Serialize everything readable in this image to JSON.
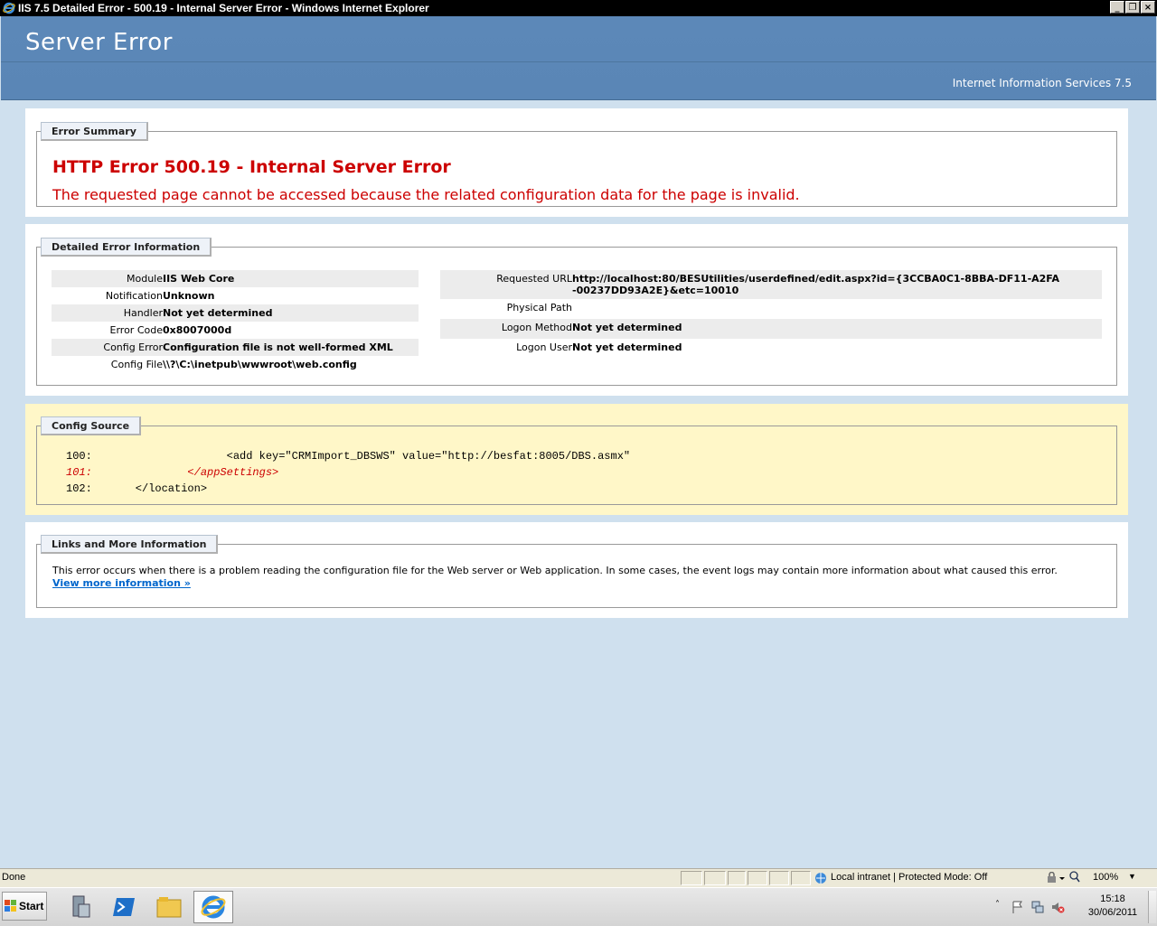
{
  "window": {
    "title": "IIS 7.5 Detailed Error - 500.19 - Internal Server Error - Windows Internet Explorer",
    "minimize": "_",
    "restore": "❐",
    "close": "×"
  },
  "header": {
    "title": "Server Error",
    "product": "Internet Information Services 7.5"
  },
  "summary": {
    "legend": "Error Summary",
    "heading": "HTTP Error 500.19 - Internal Server Error",
    "description": "The requested page cannot be accessed because the related configuration data for the page is invalid."
  },
  "details": {
    "legend": "Detailed Error Information",
    "left": [
      {
        "key": "Module",
        "value": "IIS Web Core"
      },
      {
        "key": "Notification",
        "value": "Unknown"
      },
      {
        "key": "Handler",
        "value": "Not yet determined"
      },
      {
        "key": "Error Code",
        "value": "0x8007000d"
      },
      {
        "key": "Config Error",
        "value": "Configuration file is not well-formed XML"
      },
      {
        "key": "Config File",
        "value": "\\\\?\\C:\\inetpub\\wwwroot\\web.config"
      }
    ],
    "right": [
      {
        "key": "Requested URL",
        "value": "http://localhost:80/BESUtilities/userdefined/edit.aspx?id={3CCBA0C1-8BBA-DF11-A2FA",
        "value2": "-00237DD93A2E}&etc=10010"
      },
      {
        "key": "Physical Path",
        "value": ""
      },
      {
        "key": "Logon Method",
        "value": "Not yet determined"
      },
      {
        "key": "Logon User",
        "value": "Not yet determined"
      }
    ]
  },
  "config_source": {
    "legend": "Config Source",
    "lines": [
      {
        "num": "100:",
        "code": "                  <add key=\"CRMImport_DBSWS\" value=\"http://besfat:8005/DBS.asmx\""
      },
      {
        "num": "101:",
        "code": "            </appSettings>"
      },
      {
        "num": "102:",
        "code": "    </location>"
      }
    ]
  },
  "links": {
    "legend": "Links and More Information",
    "text": "This error occurs when there is a problem reading the configuration file for the Web server or Web application. In some cases, the event logs may contain more information about what caused this error.",
    "more": "View more information »"
  },
  "statusbar": {
    "status": "Done",
    "zone": "Local intranet | Protected Mode: Off",
    "zoom": "100%"
  },
  "taskbar": {
    "start": "Start",
    "time": "15:18",
    "date": "30/06/2011"
  },
  "colors": {
    "header_blue": "#5a86b6",
    "error_red": "#cc0000",
    "page_bg": "#cfe0ee",
    "config_bg": "#fff7c8"
  }
}
